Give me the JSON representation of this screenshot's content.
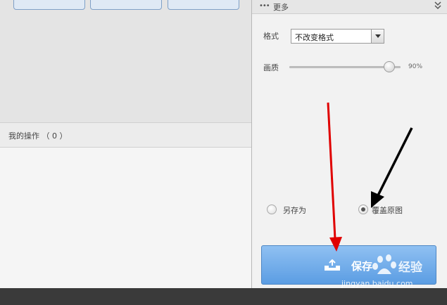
{
  "left": {
    "ops_label": "我的操作 （ 0 ）"
  },
  "right": {
    "header_dots": "•••",
    "header_title": "更多",
    "format_label": "格式",
    "format_value": "不改变格式",
    "quality_label": "画质",
    "quality_value": "90%",
    "quality_level": 0.9,
    "radio_save_as": "另存为",
    "radio_overwrite": "覆盖原图",
    "selected_option": "覆盖原图",
    "save_label": "保存"
  },
  "watermark": {
    "text": "jingyan.baidu.com"
  },
  "colors": {
    "save_button": "#6aa9ea",
    "annotation_red": "#e00000",
    "annotation_black": "#000000"
  }
}
